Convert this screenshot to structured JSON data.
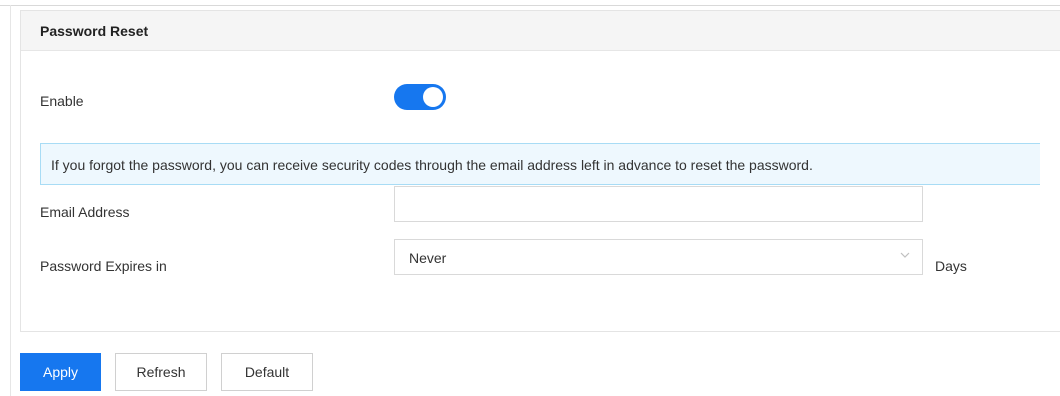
{
  "panel": {
    "title": "Password Reset"
  },
  "enable": {
    "label": "Enable",
    "on": true
  },
  "notice": {
    "text": "If you forgot the password, you can receive security codes through the email address left in advance to reset the password."
  },
  "email": {
    "label": "Email Address",
    "value": "",
    "placeholder": ""
  },
  "expires": {
    "label": "Password Expires in",
    "selected": "Never",
    "unit": "Days"
  },
  "buttons": {
    "apply": "Apply",
    "refresh": "Refresh",
    "default": "Default"
  },
  "colors": {
    "accent": "#1677ef",
    "info_bg": "#eef8fe",
    "info_border": "#a8dcf5"
  },
  "icons": {
    "dropdown": "chevron-down-icon"
  }
}
